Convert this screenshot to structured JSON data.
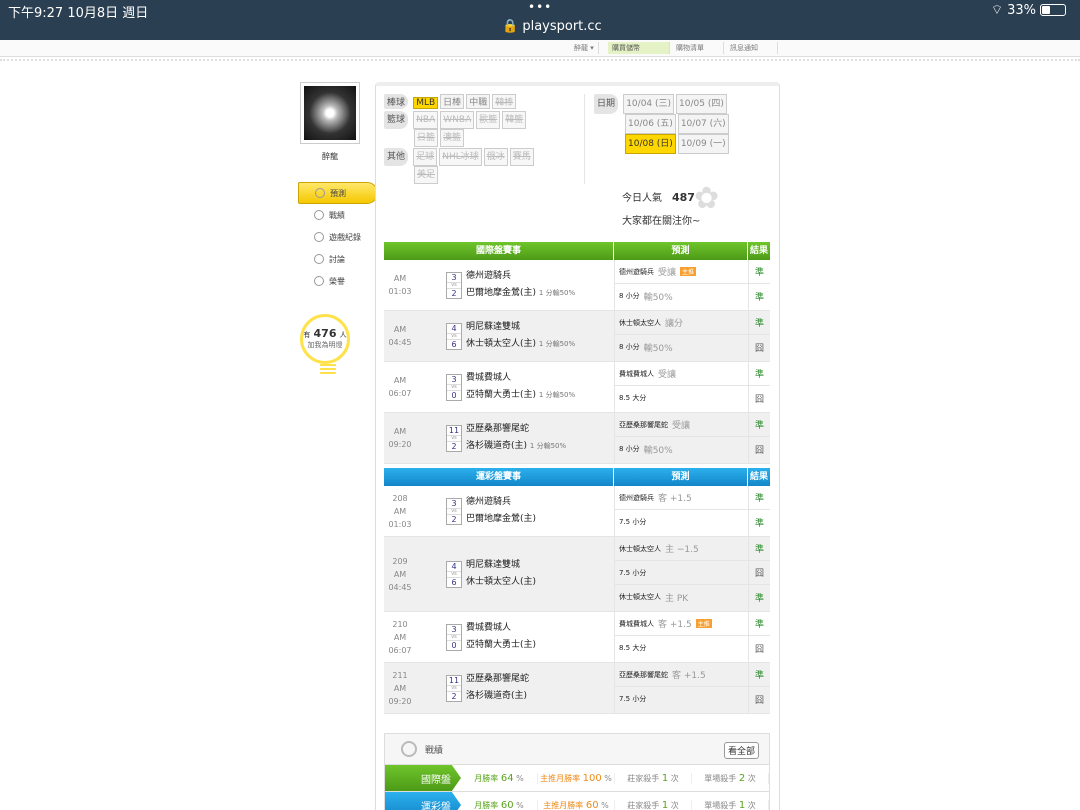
{
  "statusbar": {
    "time": "下午9:27  10月8日 週日",
    "dots": "•••",
    "url": "playsport.cc",
    "battery": "33%"
  },
  "topnav": {
    "items": [
      "醉龍 ▾",
      "購買儲幣",
      "購物清單",
      "訊息通知"
    ]
  },
  "user": {
    "name": "醉龍"
  },
  "profile_nav": {
    "items": [
      "預測",
      "戰績",
      "遊戲紀錄",
      "討論",
      "榮譽"
    ]
  },
  "bulb": {
    "prefix": "有",
    "count": "476",
    "suffix": "人",
    "sub": "加我為明燈"
  },
  "filters": {
    "baseball_label": "棒球",
    "baseball": [
      "MLB",
      "日棒",
      "中職",
      "韓棒"
    ],
    "basketball_label": "籃球",
    "basketball": [
      "NBA",
      "WNBA",
      "歐籃",
      "韓籃",
      "日籃",
      "澳籃"
    ],
    "other_label": "其他",
    "other": [
      "足球",
      "NHL冰球",
      "俄冰",
      "賽馬",
      "美足"
    ],
    "date_label": "日期",
    "dates": [
      "10/04 (三)",
      "10/05 (四)",
      "10/06 (五)",
      "10/07 (六)",
      "10/08 (日)",
      "10/09 (一)"
    ]
  },
  "stats": {
    "popularity_label": "今日人氣",
    "popularity": "487",
    "follow_text": "大家都在關注你~"
  },
  "intl": {
    "header": [
      "國際盤賽事",
      "預測",
      "結果"
    ],
    "games": [
      {
        "ampm": "AM",
        "time": "01:03",
        "s1": "3",
        "s2": "2",
        "t1": "德州遊騎兵",
        "t2": "巴爾地摩金鶯(主)",
        "odds": "1 分輸50%",
        "p": [
          {
            "team": "德州遊騎兵",
            "pick": "受讓",
            "hot": "主推"
          },
          {
            "team": "8 小分",
            "pick": "輸50%",
            "hot": ""
          }
        ],
        "r": [
          "準",
          "準"
        ]
      },
      {
        "ampm": "AM",
        "time": "04:45",
        "s1": "4",
        "s2": "6",
        "t1": "明尼蘇達雙城",
        "t2": "休士頓太空人(主)",
        "odds": "1 分輸50%",
        "p": [
          {
            "team": "休士頓太空人",
            "pick": "讓分",
            "hot": ""
          },
          {
            "team": "8 小分",
            "pick": "輸50%",
            "hot": ""
          }
        ],
        "r": [
          "準",
          "囧"
        ]
      },
      {
        "ampm": "AM",
        "time": "06:07",
        "s1": "3",
        "s2": "0",
        "t1": "費城費城人",
        "t2": "亞特蘭大勇士(主)",
        "odds": "1 分輸50%",
        "p": [
          {
            "team": "費城費城人",
            "pick": "受讓",
            "hot": ""
          },
          {
            "team": "8.5 大分",
            "pick": "",
            "hot": ""
          }
        ],
        "r": [
          "準",
          "囧"
        ]
      },
      {
        "ampm": "AM",
        "time": "09:20",
        "s1": "11",
        "s2": "2",
        "t1": "亞歷桑那響尾蛇",
        "t2": "洛杉磯道奇(主)",
        "odds": "1 分輸50%",
        "p": [
          {
            "team": "亞歷桑那響尾蛇",
            "pick": "受讓",
            "hot": ""
          },
          {
            "team": "8 小分",
            "pick": "輸50%",
            "hot": ""
          }
        ],
        "r": [
          "準",
          "囧"
        ]
      }
    ]
  },
  "lottery": {
    "header": [
      "運彩盤賽事",
      "預測",
      "結果"
    ],
    "games": [
      {
        "no": "208",
        "ampm": "AM",
        "time": "01:03",
        "s1": "3",
        "s2": "2",
        "t1": "德州遊騎兵",
        "t2": "巴爾地摩金鶯(主)",
        "p": [
          {
            "team": "德州遊騎兵",
            "pick": "客 +1.5",
            "hot": ""
          },
          {
            "team": "7.5 小分",
            "pick": "",
            "hot": ""
          }
        ],
        "r": [
          "準",
          "準"
        ]
      },
      {
        "no": "209",
        "ampm": "AM",
        "time": "04:45",
        "s1": "4",
        "s2": "6",
        "t1": "明尼蘇達雙城",
        "t2": "休士頓太空人(主)",
        "p": [
          {
            "team": "休士頓太空人",
            "pick": "主 −1.5",
            "hot": ""
          },
          {
            "team": "7.5 小分",
            "pick": "",
            "hot": ""
          },
          {
            "team": "休士頓太空人",
            "pick": "主 PK",
            "hot": ""
          }
        ],
        "r": [
          "準",
          "囧",
          "準"
        ]
      },
      {
        "no": "210",
        "ampm": "AM",
        "time": "06:07",
        "s1": "3",
        "s2": "0",
        "t1": "費城費城人",
        "t2": "亞特蘭大勇士(主)",
        "p": [
          {
            "team": "費城費城人",
            "pick": "客 +1.5",
            "hot": "主推"
          },
          {
            "team": "8.5 大分",
            "pick": "",
            "hot": ""
          }
        ],
        "r": [
          "準",
          "囧"
        ]
      },
      {
        "no": "211",
        "ampm": "AM",
        "time": "09:20",
        "s1": "11",
        "s2": "2",
        "t1": "亞歷桑那響尾蛇",
        "t2": "洛杉磯道奇(主)",
        "p": [
          {
            "team": "亞歷桑那響尾蛇",
            "pick": "客 +1.5",
            "hot": ""
          },
          {
            "team": "7.5 小分",
            "pick": "",
            "hot": ""
          }
        ],
        "r": [
          "準",
          "囧"
        ]
      }
    ]
  },
  "record": {
    "title": "戰績",
    "view_all": "看全部",
    "rows": [
      {
        "cat": "國際盤",
        "month_label": "月勝率",
        "month": "64",
        "hot_label": "主推月勝率",
        "hot": "100",
        "kill_label": "莊家殺手",
        "kill": "1",
        "single_label": "單場殺手",
        "single": "2",
        "unit": "次"
      },
      {
        "cat": "運彩盤",
        "month_label": "月勝率",
        "month": "60",
        "hot_label": "主推月勝率",
        "hot": "60",
        "kill_label": "莊家殺手",
        "kill": "1",
        "single_label": "單場殺手",
        "single": "1",
        "unit": "次"
      }
    ]
  },
  "colors": {
    "green": "#5aa51e",
    "blue": "#1a9ce0",
    "yellow": "#ffd700"
  }
}
